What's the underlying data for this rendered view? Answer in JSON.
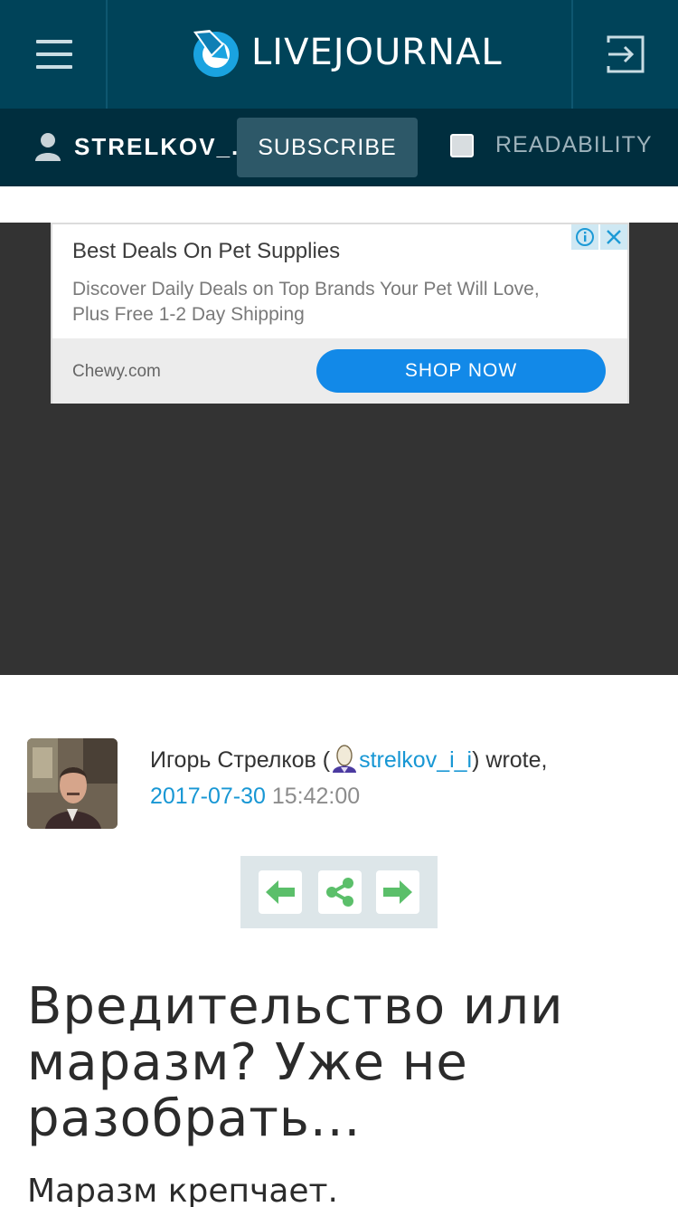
{
  "header": {
    "logo_text": "LIVEJOURNAL",
    "menu_icon": "hamburger-icon",
    "login_icon": "login-icon"
  },
  "subbar": {
    "username": "STRELKOV_...",
    "subscribe_label": "SUBSCRIBE",
    "readability_label": "READABILITY",
    "readability_checked": false
  },
  "ad": {
    "title": "Best Deals On Pet Supplies",
    "description": "Discover Daily Deals on Top Brands Your Pet Will Love, Plus Free 1-2 Day Shipping",
    "domain": "Chewy.com",
    "cta_label": "SHOP NOW"
  },
  "post": {
    "author_name": "Игорь Стрелков (",
    "author_username": "strelkov_i_i",
    "author_suffix": ") wrote,",
    "date": "2017-07-30",
    "time": "15:42:00",
    "title": "Вредительство или маразм? Уже не разобрать...",
    "body_start": "Маразм крепчает."
  },
  "colors": {
    "header_bg": "#004359",
    "subbar_bg": "#002e3e",
    "link": "#1897d4",
    "nav_green": "#5bbf6a",
    "cta_blue": "#1289e8"
  }
}
